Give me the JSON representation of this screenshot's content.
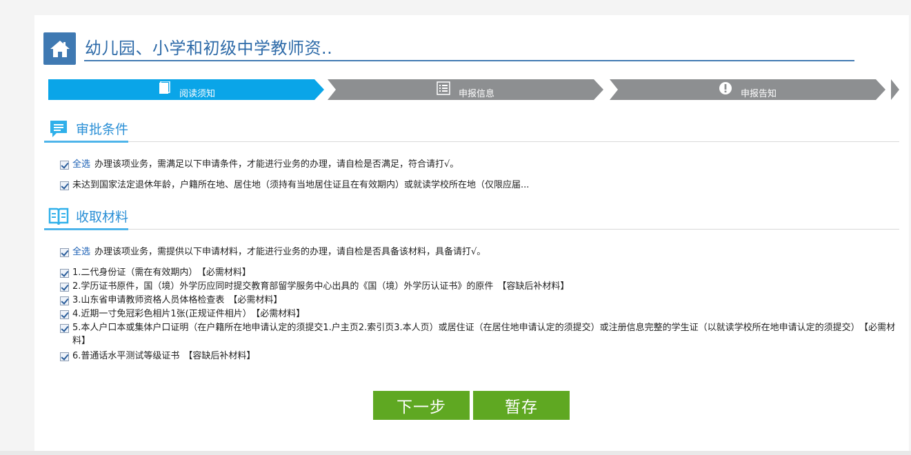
{
  "header": {
    "title": "幼儿园、小学和初级中学教师资..",
    "icon": "home-icon"
  },
  "steps": [
    {
      "label": "阅读须知",
      "icon": "book-icon",
      "active": true,
      "color": "#0aa5e8"
    },
    {
      "label": "申报信息",
      "icon": "list-icon",
      "active": false,
      "color": "#8d8f91"
    },
    {
      "label": "申报告知",
      "icon": "exclamation-icon",
      "active": false,
      "color": "#8d8f91"
    }
  ],
  "conditions": {
    "heading": "审批条件",
    "icon": "chat-icon",
    "select_all": "全选",
    "intro": "办理该项业务，需满足以下申请条件，才能进行业务的办理，请自检是否满足，符合请打√。",
    "items": [
      "未达到国家法定退休年龄，户籍所在地、居住地（须持有当地居住证且在有效期内）或就读学校所在地（仅限应届..."
    ]
  },
  "materials": {
    "heading": "收取材料",
    "icon": "open-book-icon",
    "select_all": "全选",
    "intro": "办理该项业务，需提供以下申请材料，才能进行业务的办理，请自检是否具备该材料，具备请打√。",
    "items": [
      {
        "text": "1.二代身份证（需在有效期内）",
        "tag": "【必需材料】"
      },
      {
        "text": "2.学历证书原件，国（境）外学历应同时提交教育部留学服务中心出具的《国（境）外学历认证书》的原件",
        "tag": "【容缺后补材料】"
      },
      {
        "text": "3.山东省申请教师资格人员体格检查表",
        "tag": "【必需材料】"
      },
      {
        "text": "4.近期一寸免冠彩色相片1张(正规证件相片）",
        "tag": "【必需材料】"
      },
      {
        "text": "5.本人户口本或集体户口证明（在户籍所在地申请认定的须提交1.户主页2.索引页3.本人页）或居住证（在居住地申请认定的须提交）或注册信息完整的学生证（以就读学校所在地申请认定的须提交）",
        "tag": "【必需材料】"
      },
      {
        "text": "6.普通话水平测试等级证书",
        "tag": "【容缺后补材料】"
      }
    ]
  },
  "buttons": {
    "next": "下一步",
    "save": "暂存"
  },
  "colors": {
    "accent": "#0aa5e8",
    "title_blue": "#3f79b2",
    "button_green": "#5fa822"
  }
}
